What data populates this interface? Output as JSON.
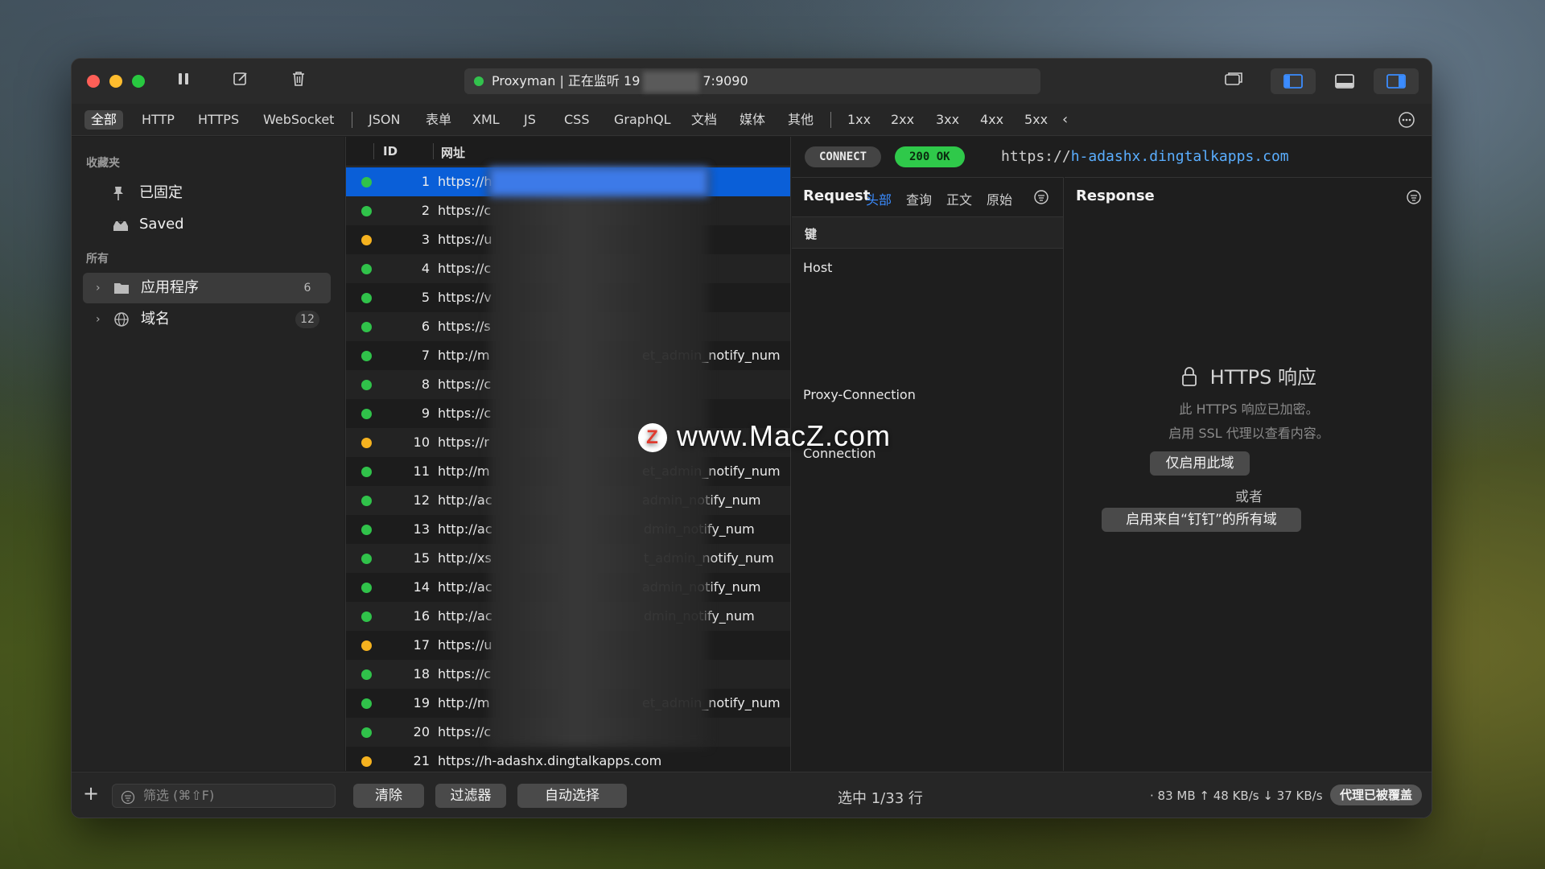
{
  "titlebar": {
    "status": "Proxyman | 正在监听 19",
    "status_tail": "7:9090"
  },
  "filter_tabs": [
    "全部",
    "HTTP",
    "HTTPS",
    "WebSocket",
    "JSON",
    "表单",
    "XML",
    "JS",
    "CSS",
    "GraphQL",
    "文档",
    "媒体",
    "其他",
    "1xx",
    "2xx",
    "3xx",
    "4xx",
    "5xx"
  ],
  "sidebar": {
    "favorites_title": "收藏夹",
    "pinned": "已固定",
    "saved": "Saved",
    "all_title": "所有",
    "apps": {
      "label": "应用程序",
      "count": "6"
    },
    "domains": {
      "label": "域名",
      "count": "12"
    }
  },
  "list": {
    "col_id": "ID",
    "col_url": "网址",
    "rows": [
      {
        "id": "1",
        "url": "https://h",
        "tail": "",
        "status": "ok"
      },
      {
        "id": "2",
        "url": "https://c",
        "tail": "",
        "status": "ok"
      },
      {
        "id": "3",
        "url": "https://u",
        "tail": "",
        "status": "pending"
      },
      {
        "id": "4",
        "url": "https://c",
        "tail": "",
        "status": "ok"
      },
      {
        "id": "5",
        "url": "https://v",
        "tail": "",
        "status": "ok"
      },
      {
        "id": "6",
        "url": "https://s",
        "tail": "",
        "status": "ok"
      },
      {
        "id": "7",
        "url": "http://m",
        "tail": "et_admin_notify_num",
        "status": "ok"
      },
      {
        "id": "8",
        "url": "https://c",
        "tail": "",
        "status": "ok"
      },
      {
        "id": "9",
        "url": "https://c",
        "tail": "",
        "status": "ok"
      },
      {
        "id": "10",
        "url": "https://r",
        "tail": "",
        "status": "pending"
      },
      {
        "id": "11",
        "url": "http://m",
        "tail": "et_admin_notify_num",
        "status": "ok"
      },
      {
        "id": "12",
        "url": "http://ac",
        "tail": "admin_notify_num",
        "status": "ok"
      },
      {
        "id": "13",
        "url": "http://ac",
        "tail": "dmin_notify_num",
        "status": "ok"
      },
      {
        "id": "15",
        "url": "http://xs",
        "tail": "t_admin_notify_num",
        "status": "ok"
      },
      {
        "id": "14",
        "url": "http://ac",
        "tail": "admin_notify_num",
        "status": "ok"
      },
      {
        "id": "16",
        "url": "http://ac",
        "tail": "dmin_notify_num",
        "status": "ok"
      },
      {
        "id": "17",
        "url": "https://u",
        "tail": "",
        "status": "pending"
      },
      {
        "id": "18",
        "url": "https://c",
        "tail": "",
        "status": "ok"
      },
      {
        "id": "19",
        "url": "http://m",
        "tail": "et_admin_notify_num",
        "status": "ok"
      },
      {
        "id": "20",
        "url": "https://c",
        "tail": "",
        "status": "ok"
      },
      {
        "id": "21",
        "url": "https://h-adashx.dingtalkapps.com",
        "tail": "",
        "status": "pending"
      }
    ]
  },
  "detail": {
    "method": "CONNECT",
    "status": "200 OK",
    "url_scheme": "https://",
    "url_host": "h-adashx.dingtalkapps.com",
    "request_title": "Request",
    "request_tabs": [
      "头部",
      "查询",
      "正文",
      "原始"
    ],
    "key_header": "键",
    "keys": [
      "Host",
      "Proxy-Connection",
      "Connection"
    ],
    "response_title": "Response",
    "https_title": "HTTPS 响应",
    "https_msg1": "此 HTTPS 响应已加密。",
    "https_msg2": "启用 SSL 代理以查看内容。",
    "enable_domain": "仅启用此域",
    "or": "或者",
    "enable_all": "启用来自“钉钉”的所有域"
  },
  "bottom": {
    "filter_placeholder": "筛选 (⌘⇧F)",
    "clear": "清除",
    "filter": "过滤器",
    "auto_select": "自动选择",
    "selection": "选中 1/33 行",
    "stats": "· 83 MB ↑ 48 KB/s ↓ 37 KB/s",
    "proxy_overridden": "代理已被覆盖"
  },
  "watermark": "www.MacZ.com",
  "colors": {
    "ok": "#30c24a",
    "pending": "#f5b21f",
    "selected": "#0a5fd8",
    "link": "#5aaeff"
  }
}
